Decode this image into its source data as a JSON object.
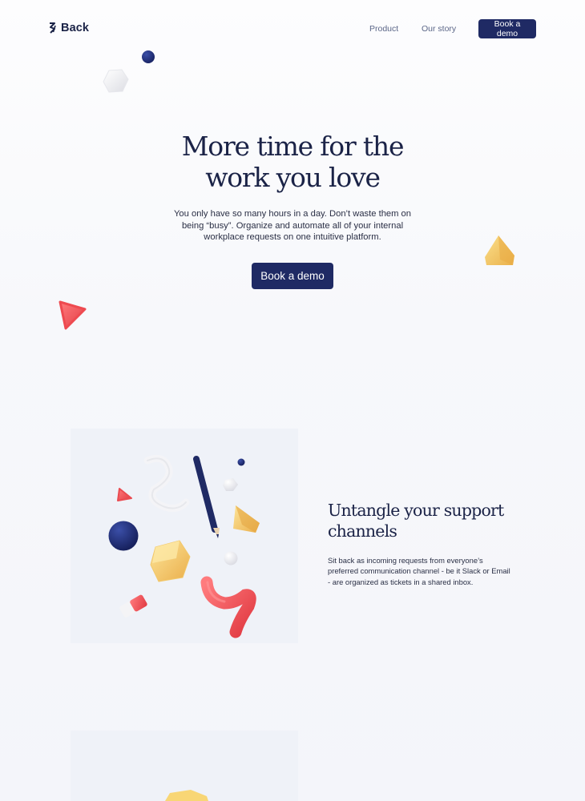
{
  "header": {
    "logo_text": "Back",
    "nav": [
      {
        "label": "Product"
      },
      {
        "label": "Our story"
      }
    ],
    "cta_label": "Book a demo"
  },
  "hero": {
    "title_line1": "More time for the",
    "title_line2": "work you love",
    "subtitle": "You only have so many hours in a day. Don’t waste them on being “busy”. Organize and automate all of your internal workplace requests on one intuitive platform.",
    "cta_label": "Book a demo"
  },
  "feature": {
    "title": "Untangle your support channels",
    "text": "Sit back as incoming requests from everyone’s preferred communication channel - be it Slack or Email - are organized as tickets in a shared inbox."
  },
  "colors": {
    "navy": "#1f2a64",
    "text": "#1b2347",
    "muted": "#5b6688",
    "red": "#ef5156",
    "yellow": "#f6c964",
    "panel": "#eff2f8"
  }
}
